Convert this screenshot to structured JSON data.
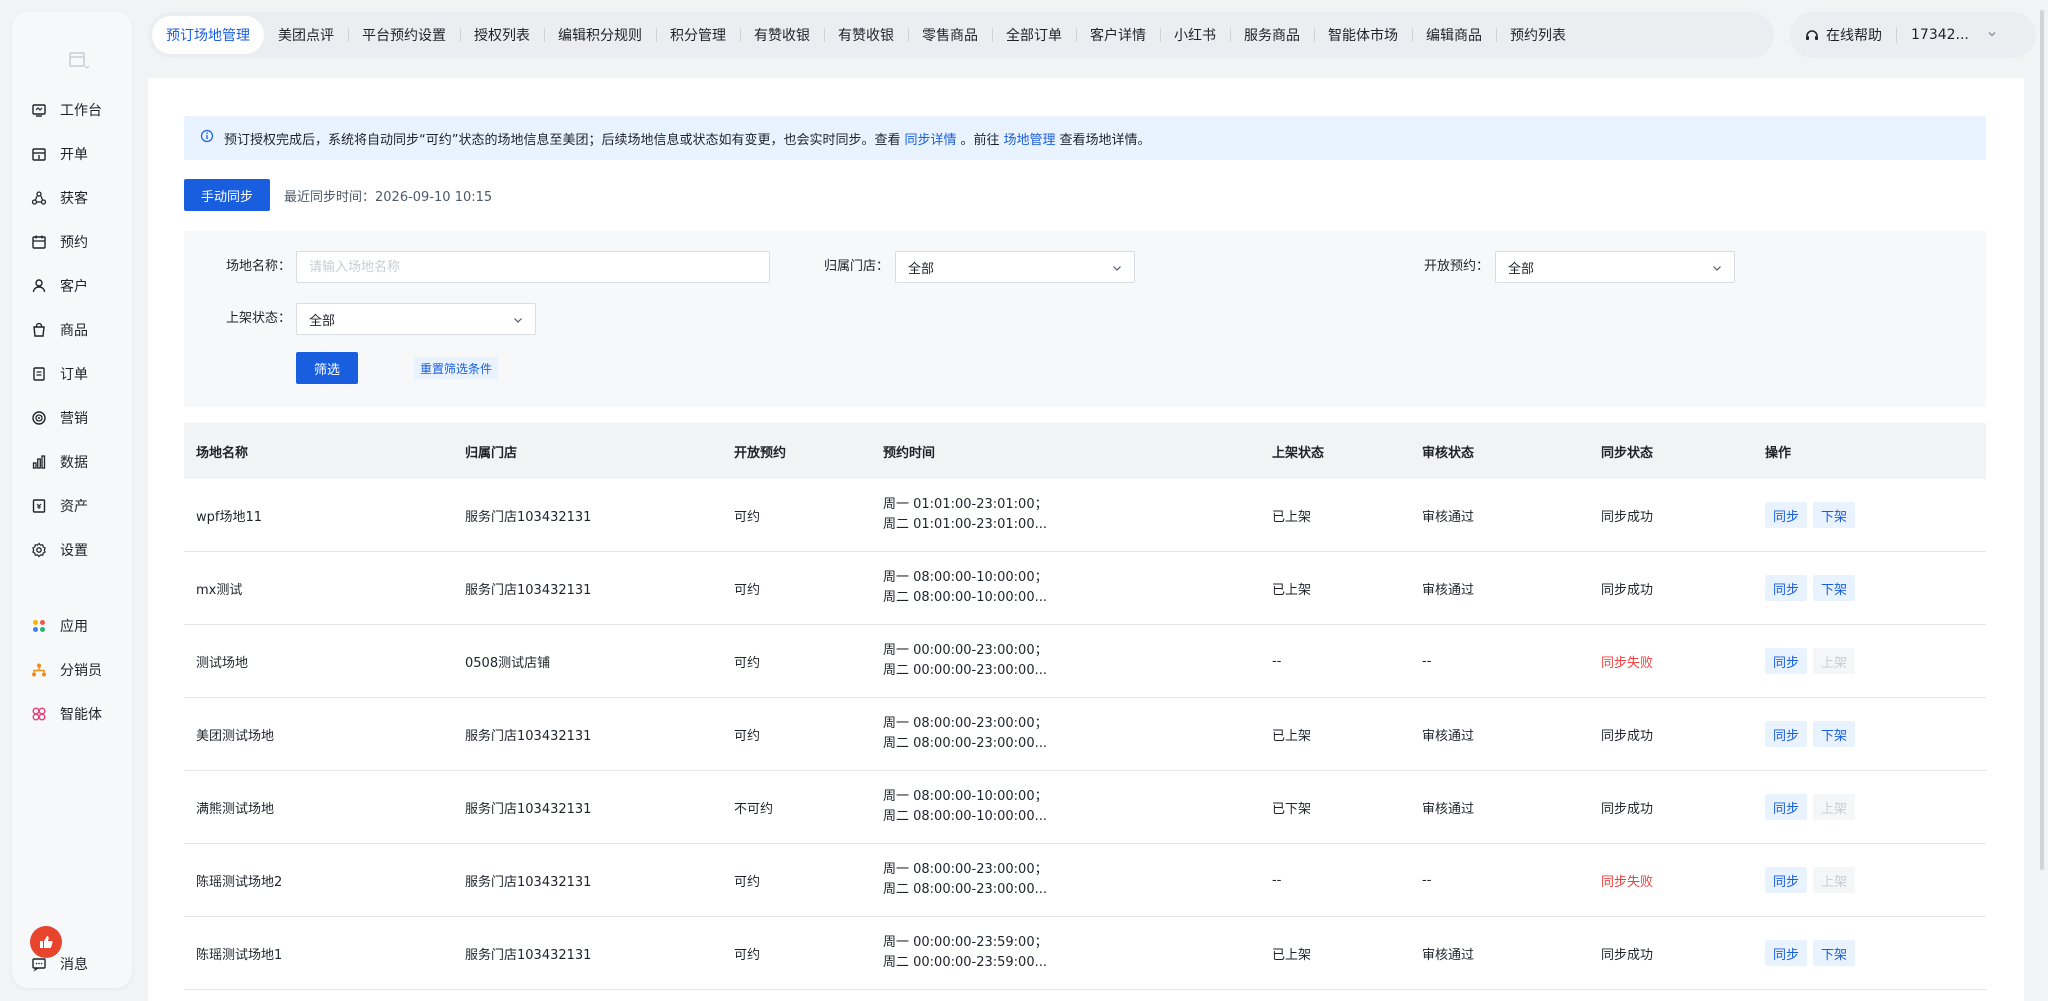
{
  "sidebar": {
    "items": [
      {
        "label": "工作台",
        "icon": "workbench-icon"
      },
      {
        "label": "开单",
        "icon": "order-create-icon"
      },
      {
        "label": "获客",
        "icon": "acquire-icon"
      },
      {
        "label": "预约",
        "icon": "calendar-icon"
      },
      {
        "label": "客户",
        "icon": "user-icon"
      },
      {
        "label": "商品",
        "icon": "bag-icon"
      },
      {
        "label": "订单",
        "icon": "doc-icon"
      },
      {
        "label": "营销",
        "icon": "target-icon"
      },
      {
        "label": "数据",
        "icon": "chart-icon"
      },
      {
        "label": "资产",
        "icon": "asset-icon"
      },
      {
        "label": "设置",
        "icon": "gear-icon"
      }
    ],
    "extra": [
      {
        "label": "应用",
        "icon": "apps-icon"
      },
      {
        "label": "分销员",
        "icon": "distributor-icon"
      },
      {
        "label": "智能体",
        "icon": "agent-icon"
      }
    ],
    "message_label": "消息"
  },
  "tabs": [
    "预订场地管理",
    "美团点评",
    "平台预约设置",
    "授权列表",
    "编辑积分规则",
    "积分管理",
    "有赞收银",
    "有赞收银",
    "零售商品",
    "全部订单",
    "客户详情",
    "小红书",
    "服务商品",
    "智能体市场",
    "编辑商品",
    "预约列表"
  ],
  "topright": {
    "help_label": "在线帮助",
    "user_label": "17342..."
  },
  "alert": {
    "text_1": "预订授权完成后，系统将自动同步“可约”状态的场地信息至美团；后续场地信息或状态如有变更，也会实时同步。查看",
    "link_1": "同步详情",
    "text_2": "。前往",
    "link_2": "场地管理",
    "text_3": "查看场地详情。"
  },
  "sync": {
    "button": "手动同步",
    "time_label": "最近同步时间：2026-09-10 10:15"
  },
  "filter": {
    "name_label": "场地名称：",
    "name_placeholder": "请输入场地名称",
    "store_label": "归属门店：",
    "store_value": "全部",
    "open_label": "开放预约：",
    "open_value": "全部",
    "shelf_label": "上架状态：",
    "shelf_value": "全部",
    "filter_button": "筛选",
    "reset_button": "重置筛选条件"
  },
  "table": {
    "headers": [
      "场地名称",
      "归属门店",
      "开放预约",
      "预约时间",
      "上架状态",
      "审核状态",
      "同步状态",
      "操作"
    ],
    "rows": [
      {
        "name": "wpf场地11",
        "store": "服务门店103432131",
        "open": "可约",
        "time1": "周一 01:01:00-23:01:00；",
        "time2": "周二 01:01:00-23:01:00...",
        "shelf": "已上架",
        "audit": "审核通过",
        "sync": "同步成功",
        "sync_fail": false,
        "op1": "同步",
        "op2": "下架",
        "op2_disabled": false
      },
      {
        "name": "mx测试",
        "store": "服务门店103432131",
        "open": "可约",
        "time1": "周一 08:00:00-10:00:00；",
        "time2": "周二 08:00:00-10:00:00...",
        "shelf": "已上架",
        "audit": "审核通过",
        "sync": "同步成功",
        "sync_fail": false,
        "op1": "同步",
        "op2": "下架",
        "op2_disabled": false
      },
      {
        "name": "测试场地",
        "store": "0508测试店铺",
        "open": "可约",
        "time1": "周一 00:00:00-23:00:00；",
        "time2": "周二 00:00:00-23:00:00...",
        "shelf": "--",
        "audit": "--",
        "sync": "同步失败",
        "sync_fail": true,
        "op1": "同步",
        "op2": "上架",
        "op2_disabled": true
      },
      {
        "name": "美团测试场地",
        "store": "服务门店103432131",
        "open": "可约",
        "time1": "周一 08:00:00-23:00:00；",
        "time2": "周二 08:00:00-23:00:00...",
        "shelf": "已上架",
        "audit": "审核通过",
        "sync": "同步成功",
        "sync_fail": false,
        "op1": "同步",
        "op2": "下架",
        "op2_disabled": false
      },
      {
        "name": "满熊测试场地",
        "store": "服务门店103432131",
        "open": "不可约",
        "time1": "周一 08:00:00-10:00:00；",
        "time2": "周二 08:00:00-10:00:00...",
        "shelf": "已下架",
        "audit": "审核通过",
        "sync": "同步成功",
        "sync_fail": false,
        "op1": "同步",
        "op2": "上架",
        "op2_disabled": true
      },
      {
        "name": "陈瑶测试场地2",
        "store": "服务门店103432131",
        "open": "可约",
        "time1": "周一 08:00:00-23:00:00；",
        "time2": "周二 08:00:00-23:00:00...",
        "shelf": "--",
        "audit": "--",
        "sync": "同步失败",
        "sync_fail": true,
        "op1": "同步",
        "op2": "上架",
        "op2_disabled": true
      },
      {
        "name": "陈瑶测试场地1",
        "store": "服务门店103432131",
        "open": "可约",
        "time1": "周一 00:00:00-23:59:00；",
        "time2": "周二 00:00:00-23:59:00...",
        "shelf": "已上架",
        "audit": "审核通过",
        "sync": "同步成功",
        "sync_fail": false,
        "op1": "同步",
        "op2": "下架",
        "op2_disabled": false
      }
    ]
  }
}
